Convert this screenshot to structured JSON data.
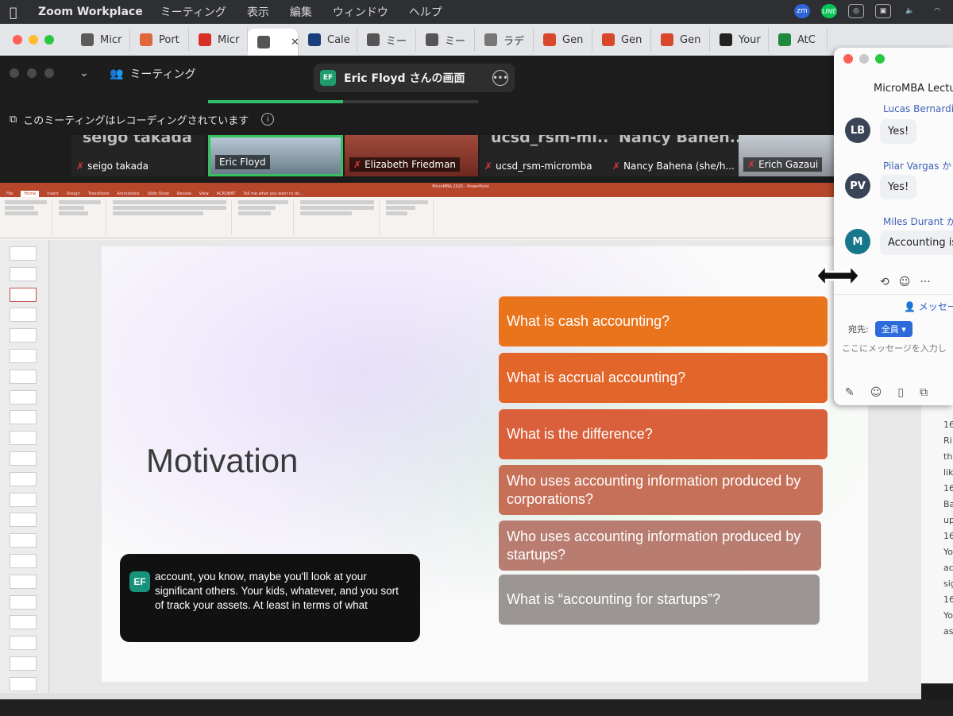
{
  "menubar": {
    "app": "Zoom Workplace",
    "items": [
      "ミーティング",
      "表示",
      "編集",
      "ウィンドウ",
      "ヘルプ"
    ],
    "status_icons": [
      "zm",
      "LINE"
    ]
  },
  "browser_tabs": [
    {
      "label": "Micr",
      "icon": "microsoft-icon",
      "color": "#5b5b5b"
    },
    {
      "label": "Port",
      "icon": "asterisk-icon",
      "color": "#e0663c"
    },
    {
      "label": "Micr",
      "icon": "gmail-icon",
      "color": "#d93025"
    },
    {
      "label": "",
      "icon": "globe-icon",
      "color": "#555555",
      "active": true
    },
    {
      "label": "Cale",
      "icon": "uc-icon",
      "color": "#1a3d7c"
    },
    {
      "label": "ミー",
      "icon": "globe-icon",
      "color": "#555555"
    },
    {
      "label": "ミー",
      "icon": "globe-icon",
      "color": "#555555"
    },
    {
      "label": "ラデ",
      "icon": "gear-icon",
      "color": "#777777"
    },
    {
      "label": "Gen",
      "icon": "ribbon-icon",
      "color": "#d9482b"
    },
    {
      "label": "Gen",
      "icon": "ribbon-icon",
      "color": "#d9482b"
    },
    {
      "label": "Gen",
      "icon": "ribbon-icon",
      "color": "#d9482b"
    },
    {
      "label": "Your",
      "icon": "github-icon",
      "color": "#222222"
    },
    {
      "label": "AtC",
      "icon": "ac-icon",
      "color": "#1e8a3c"
    }
  ],
  "zoom": {
    "meeting_label": "ミーティング",
    "share_initials": "EF",
    "share_label": "Eric Floyd さんの画面",
    "recording_notice": "このミーティングはレコーディングされています",
    "share_progress": 0.5
  },
  "participants": [
    {
      "big": "seigo takada",
      "name": "seigo takada",
      "muted": true
    },
    {
      "big": "",
      "name": "Eric Floyd",
      "muted": false,
      "active": true
    },
    {
      "big": "",
      "name": "Elizabeth Friedman",
      "muted": true
    },
    {
      "big": "ucsd_rsm-mi...",
      "name": "ucsd_rsm-micromba",
      "muted": true
    },
    {
      "big": "Nancy Bahen...",
      "name": "Nancy Bahena (she/h...",
      "muted": true
    },
    {
      "big": "",
      "name": "Erich Gazaui",
      "muted": true
    }
  ],
  "ppt": {
    "window_title": "MicroMBA 2025 - PowerPoint",
    "menus": [
      "File",
      "Home",
      "Insert",
      "Design",
      "Transitions",
      "Animations",
      "Slide Show",
      "Review",
      "View",
      "ACROBAT",
      "Tell me what you want to do..."
    ]
  },
  "slide": {
    "title": "Motivation",
    "questions": [
      {
        "text": "What is cash accounting?",
        "color": "#e9741c"
      },
      {
        "text": "What is accrual accounting?",
        "color": "#e2652a"
      },
      {
        "text": "What is the difference?",
        "color": "#d9603a"
      },
      {
        "text": "Who uses accounting information produced by corporations?",
        "color": "#c77058"
      },
      {
        "text": "Who uses accounting information produced by startups?",
        "color": "#b87c70"
      },
      {
        "text": "What is “accounting for startups”?",
        "color": "#9b9593"
      }
    ]
  },
  "caption": {
    "initials": "EF",
    "text": "account, you know, maybe you'll look at your significant others. Your kids, whatever, and you sort of track your assets. At least in terms of what"
  },
  "chat": {
    "title": "MicroMBA Lectu",
    "messages": [
      {
        "initials": "LB",
        "sender": "Lucas Bernardin",
        "text": "Yes!",
        "color": "#3a4457"
      },
      {
        "initials": "PV",
        "sender": "Pilar Vargas から",
        "text": "Yes!",
        "color": "#3a4457"
      },
      {
        "initials": "M",
        "sender": "Miles Durant から",
        "text": "Accounting is t",
        "color": "#17778a"
      }
    ],
    "new_message": "メッセー",
    "to_label": "宛先:",
    "to_value": "全員",
    "placeholder": "ここにメッセージを入力し"
  },
  "chat_log_fragments": [
    "16",
    "Ri",
    "th",
    "lik",
    "16",
    "Ba",
    "up",
    "16",
    "Yo",
    "ac",
    "sig",
    "16",
    "You",
    "ass"
  ]
}
